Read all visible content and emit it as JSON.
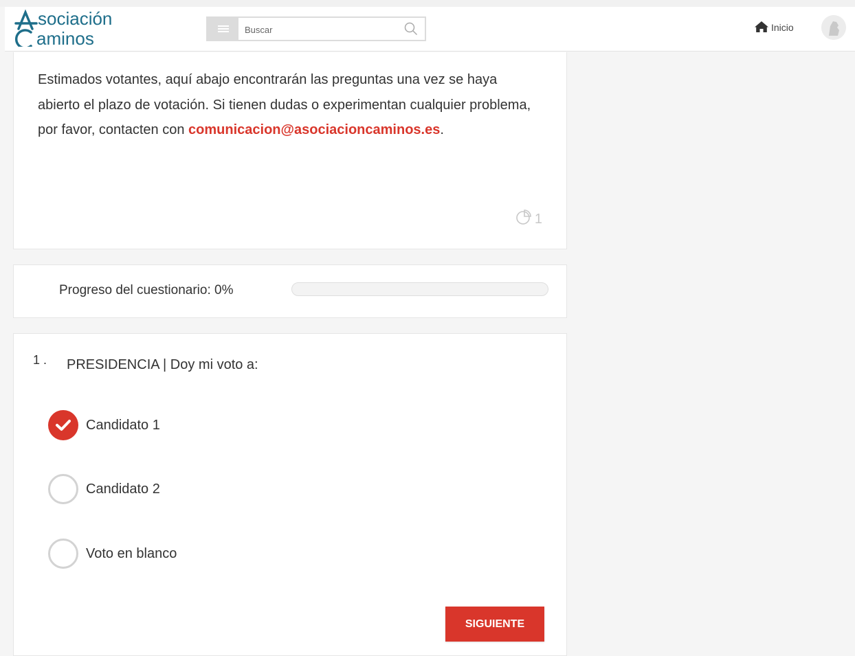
{
  "header": {
    "logo_alt": "Asociación Caminos",
    "logo_line1": "sociación",
    "logo_line2": "aminos",
    "search_placeholder": "Buscar",
    "home_label": "Inicio"
  },
  "intro": {
    "text_before": "Estimados votantes, aquí abajo encontrarán las preguntas una vez se haya abierto el plazo de votación. Si tienen dudas o experimentan cualquier problema, por favor, contacten con ",
    "email": "comunicacion@asociacioncaminos.es",
    "text_after": ".",
    "stat_count": "1",
    "stat_icon": "pie-chart-icon"
  },
  "progress": {
    "label": "Progreso del cuestionario: 0%",
    "value_percent": 0
  },
  "question": {
    "number": "1 .",
    "text": "PRESIDENCIA | Doy mi voto a:",
    "options": [
      {
        "label": "Candidato 1",
        "selected": true
      },
      {
        "label": "Candidato 2",
        "selected": false
      },
      {
        "label": "Voto en blanco",
        "selected": false
      }
    ],
    "next_label": "SIGUIENTE"
  },
  "colors": {
    "accent": "#d9362b",
    "logo": "#1e6e8a"
  }
}
